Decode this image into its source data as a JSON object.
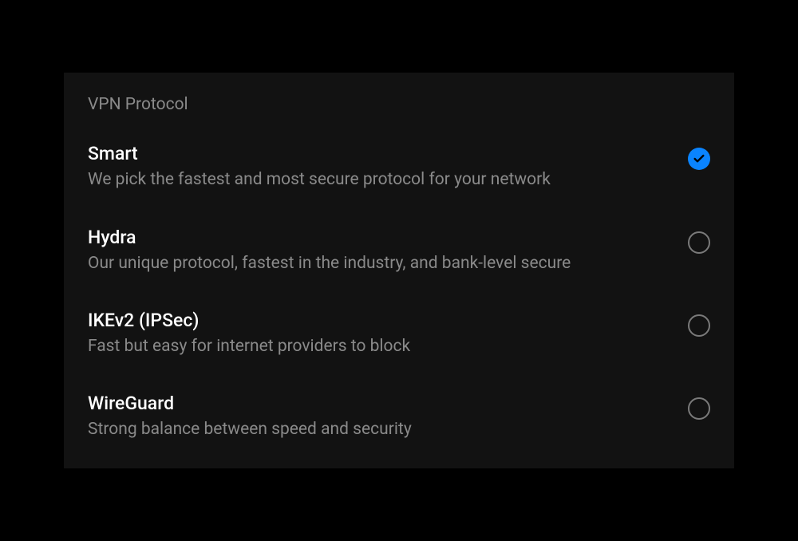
{
  "section": {
    "header": "VPN Protocol"
  },
  "options": [
    {
      "title": "Smart",
      "description": "We pick the fastest and most secure protocol for your network",
      "selected": true
    },
    {
      "title": "Hydra",
      "description": "Our unique protocol, fastest in the industry, and bank-level secure",
      "selected": false
    },
    {
      "title": "IKEv2 (IPSec)",
      "description": "Fast but easy for internet providers to block",
      "selected": false
    },
    {
      "title": "WireGuard",
      "description": "Strong balance between speed and security",
      "selected": false
    }
  ],
  "colors": {
    "accent": "#0a84ff",
    "text_primary": "#ffffff",
    "text_secondary": "#8a8a8a",
    "panel_bg": "#121212"
  }
}
